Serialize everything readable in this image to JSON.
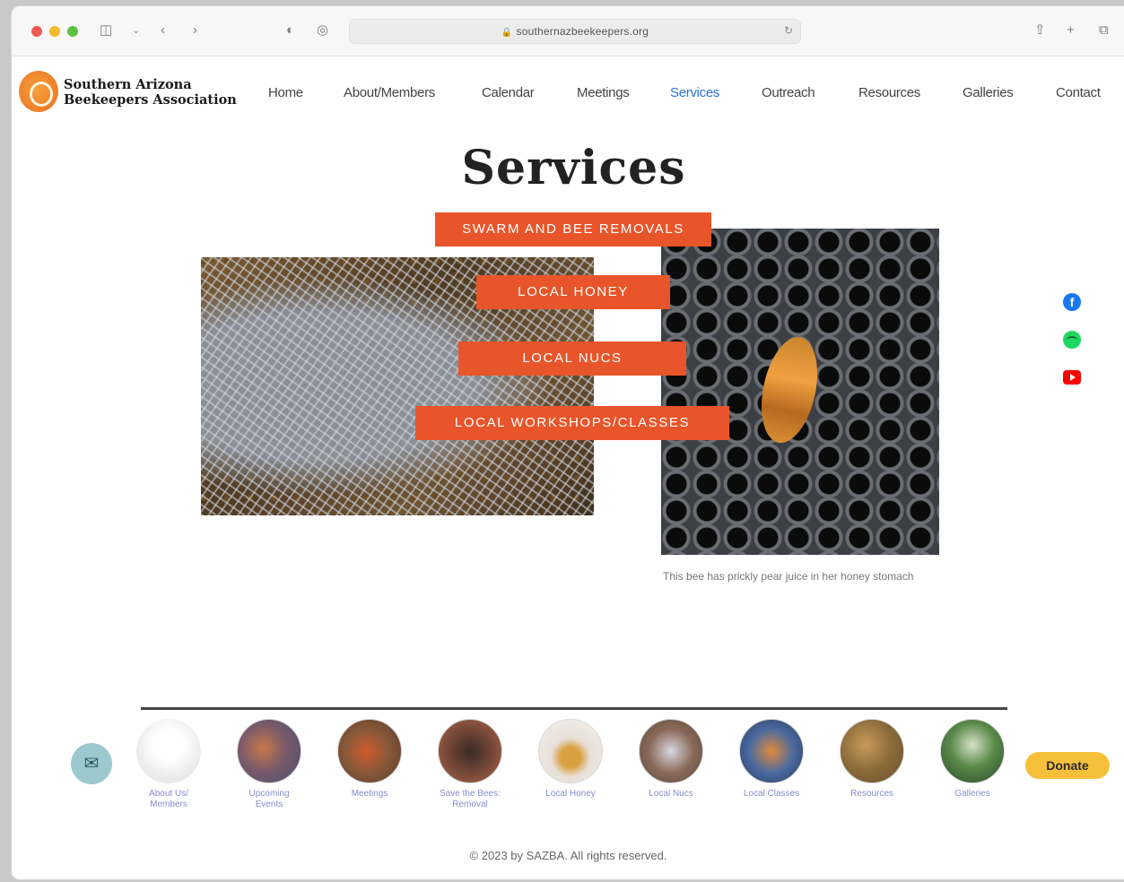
{
  "browser": {
    "url": "southernazbeekeepers.org",
    "back_icon": "chevron-left-icon",
    "forward_icon": "chevron-right-icon"
  },
  "site": {
    "logo_line1": "Southern Arizona",
    "logo_line2": "Beekeepers Association"
  },
  "nav": {
    "items": [
      "Home",
      "About/Members",
      "Calendar",
      "Meetings",
      "Services",
      "Outreach",
      "Resources",
      "Galleries",
      "Contact"
    ],
    "active": "Services"
  },
  "page": {
    "title": "Services",
    "buttons": {
      "swarm": "SWARM AND BEE REMOVALS",
      "honey": "LOCAL HONEY",
      "nucs": "LOCAL NUCS",
      "workshops": "LOCAL WORKSHOPS/CLASSES"
    },
    "comb_caption": "This bee has prickly pear juice in her honey stomach"
  },
  "social": {
    "facebook": "f"
  },
  "footer": {
    "items": [
      "About Us/ Members",
      "Upcoming Events",
      "Meetings",
      "Save the Bees: Removal",
      "Local Honey",
      "Local Nucs",
      "Local Classes",
      "Resources",
      "Galleries"
    ],
    "mail_icon": "✉",
    "donate": "Donate",
    "copyright": "© 2023 by SAZBA. All rights reserved."
  },
  "colors": {
    "accent_orange": "#e8552a",
    "nav_active": "#2f6fdf",
    "donate_yellow": "#f6c03a"
  }
}
